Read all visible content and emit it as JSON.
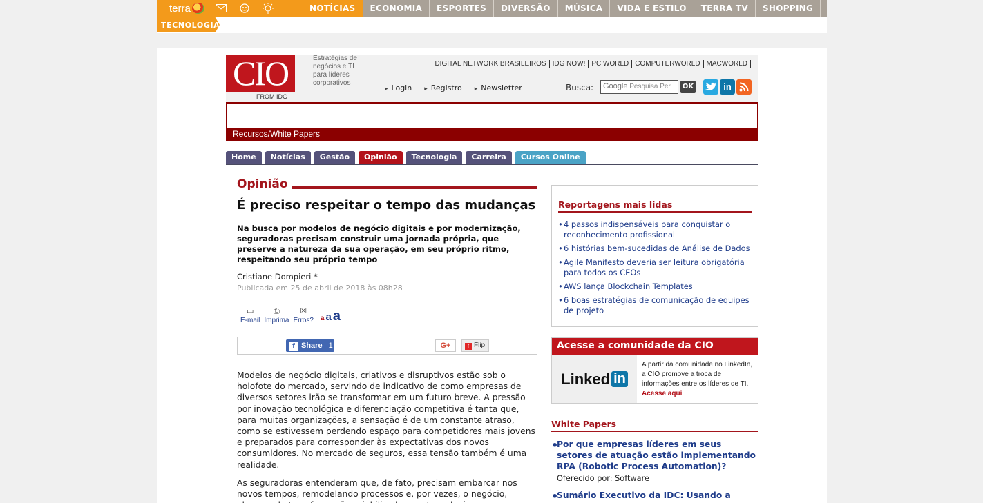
{
  "terra": {
    "logo": "terra",
    "nav": [
      "NOTÍCIAS",
      "ECONOMIA",
      "ESPORTES",
      "DIVERSÃO",
      "MÚSICA",
      "VIDA E ESTILO",
      "TERRA TV",
      "SHOPPING"
    ],
    "sub_tab": "TECNOLOGIA"
  },
  "header": {
    "logo": "CIO",
    "from": "FROM IDG",
    "tagline": "Estratégias de negócios e TI para líderes corporativos",
    "partners": [
      "DIGITAL NETWORK!BRASILEIROS",
      "IDG NOW!",
      "PC WORLD",
      "COMPUTERWORLD",
      "MACWORLD"
    ],
    "user_links": [
      "Login",
      "Registro",
      "Newsletter"
    ],
    "search_label": "Busca:",
    "search_google": "Google",
    "search_placeholder": "Pesquisa Per",
    "ok_label": "OK"
  },
  "breadcrumb": "Recursos/White Papers",
  "tabs": [
    "Home",
    "Notícias",
    "Gestão",
    "Opinião",
    "Tecnologia",
    "Carreira",
    "Cursos Online"
  ],
  "article": {
    "section": "Opinião",
    "title": "É preciso respeitar o tempo das mudanças",
    "lead": "Na busca por modelos de negócio digitais e por modernização, seguradoras precisam construir uma jornada própria, que preserve a natureza da sua operação, em seu próprio ritmo, respeitando seu próprio tempo",
    "author": "Cristiane Dompieri *",
    "date": "Publicada em 25 de abril de 2018 às 08h28",
    "tools": {
      "email": "E-mail",
      "print": "Imprima",
      "errors": "Erros?"
    },
    "font_sizes": [
      "a",
      "a",
      "a"
    ],
    "share": {
      "facebook": "Share",
      "facebook_count": "1",
      "gplus": "G+",
      "flip": "Flip"
    },
    "paragraphs": [
      "Modelos de negócio digitais, criativos e disruptivos estão sob o holofote do mercado, servindo de indicativo de como empresas de diversos setores irão se transformar em um futuro breve. A pressão por inovação tecnológica e diferenciação competitiva é tanta que, para muitas organizações, a sensação é de um constante atraso, como se estivessem perdendo espaço para competidores mais jovens e preparados para corresponder às expectativas dos novos consumidores. No mercado de seguros, essa tensão também é uma realidade.",
      "As seguradoras entenderam que, de fato, precisam embarcar nos novos tempos, remodelando processos e, por vezes, o negócio, alcançando transformações viabilizadas por tecnologias como"
    ]
  },
  "sidebar": {
    "most_read_title": "Reportagens mais lidas",
    "most_read": [
      "4 passos indispensáveis para conquistar o reconhecimento profissional",
      "6 histórias bem-sucedidas de Análise de Dados",
      "Agile Manifesto deveria ser leitura obrigatória para todos os CEOs",
      "AWS lança Blockchain Templates",
      "6 boas estratégias de comunicação de equipes de projeto"
    ],
    "community_title": "Acesse a comunidade da CIO",
    "linkedin_word": "Linked",
    "linkedin_in": "in",
    "community_text": "A partir da comunidade no LinkedIn, a CIO promove a troca de informações entre os líderes de TI.",
    "community_link": "Acesse aqui",
    "wp_title": "White Papers",
    "white_papers": [
      {
        "title": "Por que empresas líderes em seus setores de atuação estão implementando RPA (Robotic Process Automation)?",
        "sponsor": "Oferecido por: Software"
      },
      {
        "title": "Sumário Executivo da IDC: Usando a Veeam",
        "sponsor": ""
      }
    ]
  }
}
